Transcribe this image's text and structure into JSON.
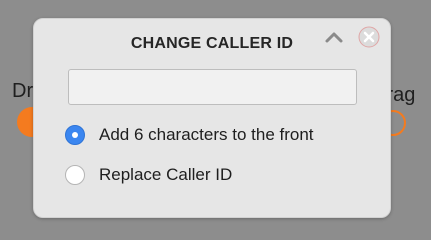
{
  "dialog": {
    "title": "CHANGE CALLER ID",
    "collapse_icon": "chevron-up-icon",
    "close_icon": "close-circle-icon",
    "input": {
      "value": "",
      "placeholder": ""
    },
    "options": [
      {
        "label": "Add 6 characters to the front",
        "selected": true
      },
      {
        "label": "Replace Caller ID",
        "selected": false
      }
    ]
  },
  "connectors": {
    "drop_label": "Drop",
    "drag_label": "Drag",
    "accent_color": "#f47b1f"
  },
  "colors": {
    "background": "#8d8d8d",
    "panel": "#e6e6e6",
    "radio_selected": "#3b86f0"
  }
}
